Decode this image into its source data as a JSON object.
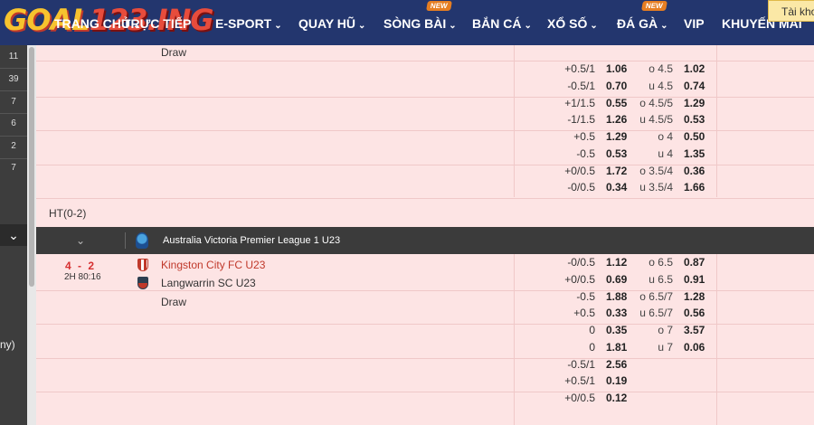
{
  "nav": {
    "logo_part1": "GOAL",
    "logo_part2": "123.ING",
    "items": [
      {
        "label": "TRANG CHỦ"
      },
      {
        "label": "TRỰC TIẾP"
      },
      {
        "label": "E-SPORT"
      },
      {
        "label": "QUAY HŨ"
      },
      {
        "label": "SÒNG BÀI"
      },
      {
        "label": "BẮN CÁ"
      },
      {
        "label": "XỔ SỐ"
      },
      {
        "label": "ĐÁ GÀ"
      },
      {
        "label": "VIP"
      },
      {
        "label": "KHUYẾN MÃI"
      }
    ],
    "new_badge": "NEW",
    "account_button": "Tài khoản",
    "colors": {
      "bar": "#23366e",
      "badge": "#e67e22"
    }
  },
  "left_panel": {
    "counts": [
      "11",
      "39",
      "7",
      "6",
      "2",
      "7"
    ],
    "partial_text": "ny)"
  },
  "match_top": {
    "draw_label": "Draw",
    "ht_label": "HT(0-2)",
    "rows": [
      {
        "hdcp": "+0.5/1",
        "odds": "1.06",
        "ou": "o 4.5",
        "ou_odds": "1.02"
      },
      {
        "hdcp": "-0.5/1",
        "odds": "0.70",
        "ou": "u 4.5",
        "ou_odds": "0.74"
      },
      {
        "hdcp": "+1/1.5",
        "odds": "0.55",
        "ou": "o 4.5/5",
        "ou_odds": "1.29"
      },
      {
        "hdcp": "-1/1.5",
        "odds": "1.26",
        "ou": "u 4.5/5",
        "ou_odds": "0.53"
      },
      {
        "hdcp": "+0.5",
        "odds": "1.29",
        "ou": "o 4",
        "ou_odds": "0.50"
      },
      {
        "hdcp": "-0.5",
        "odds": "0.53",
        "ou": "u 4",
        "ou_odds": "1.35"
      },
      {
        "hdcp": "+0/0.5",
        "odds": "1.72",
        "ou": "o 3.5/4",
        "ou_odds": "0.36"
      },
      {
        "hdcp": "-0/0.5",
        "odds": "0.34",
        "ou": "u 3.5/4",
        "ou_odds": "1.66"
      }
    ]
  },
  "league": {
    "name": "Australia Victoria Premier League 1 U23"
  },
  "match": {
    "score": "4 - 2",
    "minute": "2H 80:16",
    "home": "Kingston City FC U23",
    "away": "Langwarrin SC U23",
    "draw_label": "Draw",
    "rows": [
      {
        "hdcp": "-0/0.5",
        "odds": "1.12",
        "ou": "o 6.5",
        "ou_odds": "0.87"
      },
      {
        "hdcp": "+0/0.5",
        "odds": "0.69",
        "ou": "u 6.5",
        "ou_odds": "0.91"
      },
      {
        "hdcp": "-0.5",
        "odds": "1.88",
        "ou": "o 6.5/7",
        "ou_odds": "1.28"
      },
      {
        "hdcp": "+0.5",
        "odds": "0.33",
        "ou": "u 6.5/7",
        "ou_odds": "0.56"
      },
      {
        "hdcp": "0",
        "odds": "0.35",
        "ou": "o 7",
        "ou_odds": "3.57"
      },
      {
        "hdcp": "0",
        "odds": "1.81",
        "ou": "u 7",
        "ou_odds": "0.06"
      },
      {
        "hdcp": "-0.5/1",
        "odds": "2.56",
        "ou": "",
        "ou_odds": ""
      },
      {
        "hdcp": "+0.5/1",
        "odds": "0.19",
        "ou": "",
        "ou_odds": ""
      },
      {
        "hdcp": "+0/0.5",
        "odds": "0.12",
        "ou": "",
        "ou_odds": ""
      }
    ]
  }
}
